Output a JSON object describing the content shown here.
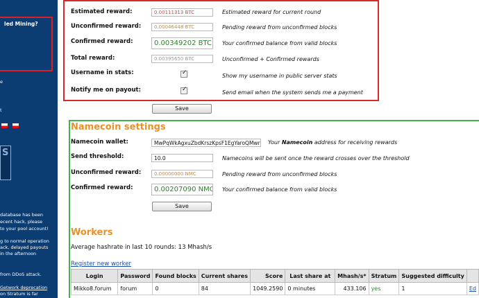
{
  "sidebar": {
    "box_title": "led Mining?",
    "lines": [
      "e",
      "t",
      "database has been",
      "ecent hack, please",
      "to your pool account!",
      "g to normal operation",
      "ack, delayed payouts",
      "in the afternoon",
      "from DDoS attack.",
      "Getwork deprecation",
      "on Stratum is far"
    ],
    "badge_letter": "S"
  },
  "bitcoin": {
    "rows": [
      {
        "label": "Estimated reward:",
        "value": "0.00111313 BTC",
        "desc": "Estimated reward for current round"
      },
      {
        "label": "Unconfirmed reward:",
        "value": "0.00046448 BTC",
        "desc": "Pending reward from unconfirmed blocks"
      },
      {
        "label": "Confirmed reward:",
        "value": "0.00349202 BTC",
        "desc": "Your confirmed balance from valid blocks"
      },
      {
        "label": "Total reward:",
        "value": "0.00395650 BTC",
        "desc": "Unconfirmed + Confirmed rewards"
      }
    ],
    "username_label": "Username in stats:",
    "username_desc": "Show my username in public server stats",
    "notify_label": "Notify me on payout:",
    "notify_desc": "Send email when the system sends me a payment",
    "save_label": "Save"
  },
  "namecoin": {
    "title": "Namecoin settings",
    "wallet_label": "Namecoin wallet:",
    "wallet_value": "MwPqWkAgxuZbdKrszKpsF1EgYaroQMwr",
    "wallet_desc_pre": "Your ",
    "wallet_desc_bold": "Namecoin",
    "wallet_desc_post": " address for receiving rewards",
    "threshold_label": "Send threshold:",
    "threshold_value": "10.0",
    "threshold_desc": "Namecoins will be sent once the reward crosses over the threshold",
    "unconfirmed_label": "Unconfirmed reward:",
    "unconfirmed_value": "0.00000000 NMC",
    "unconfirmed_desc": "Pending reward from unconfirmed blocks",
    "confirmed_label": "Confirmed reward:",
    "confirmed_value": "0.00207090 NMC",
    "confirmed_desc": "Your confirmed balance from valid blocks",
    "save_label": "Save"
  },
  "workers": {
    "title": "Workers",
    "hashrate_text": "Average hashrate in last 10 rounds: 13 Mhash/s",
    "register_link": "Register new worker",
    "columns": [
      "Login",
      "Password",
      "Found blocks",
      "Current shares",
      "Score",
      "Last share at",
      "Mhash/s*",
      "Stratum",
      "Suggested difficulty",
      ""
    ],
    "rows": [
      [
        "Mikko8.forum",
        "forum",
        "0",
        "84",
        "1049.2590",
        "0 minutes",
        "433.106",
        "yes",
        "1",
        "Ed"
      ]
    ]
  },
  "colors": {
    "sidebar_bg": "#0b3d73",
    "red_highlight": "#d42a2a",
    "green_highlight": "#3eb44a",
    "section_title": "#e8912a",
    "link": "#1a4da6"
  }
}
